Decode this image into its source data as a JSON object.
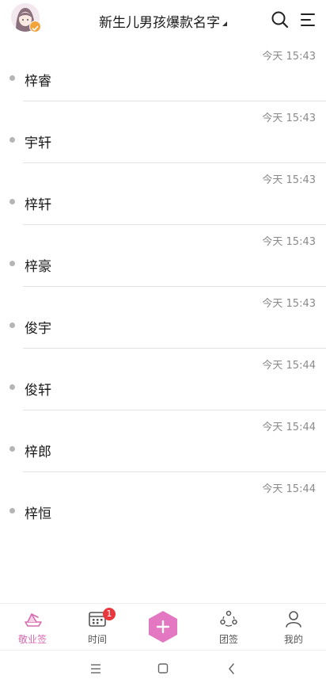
{
  "header": {
    "title": "新生儿男孩爆款名字",
    "icons": {
      "avatar": "user-avatar",
      "search": "search-icon",
      "menu": "menu-icon"
    }
  },
  "notes": [
    {
      "text": "梓睿",
      "time": "今天 15:43"
    },
    {
      "text": "宇轩",
      "time": "今天 15:43"
    },
    {
      "text": "梓轩",
      "time": "今天 15:43"
    },
    {
      "text": "梓豪",
      "time": "今天 15:43"
    },
    {
      "text": "俊宇",
      "time": "今天 15:43"
    },
    {
      "text": "俊轩",
      "time": "今天 15:44"
    },
    {
      "text": "梓郎",
      "time": "今天 15:44"
    },
    {
      "text": "梓恒",
      "time": "今天 15:44"
    }
  ],
  "tabbar": {
    "tabs": [
      {
        "label": "敬业签",
        "icon": "boat-icon",
        "active": true
      },
      {
        "label": "时间",
        "icon": "calendar-icon",
        "badge": "1"
      },
      {
        "label": "",
        "icon": "add-icon"
      },
      {
        "label": "团签",
        "icon": "team-icon"
      },
      {
        "label": "我的",
        "icon": "user-icon"
      }
    ]
  },
  "colors": {
    "accent": "#e377c2",
    "badge": "#e8383d",
    "time": "#8a8a8a"
  }
}
